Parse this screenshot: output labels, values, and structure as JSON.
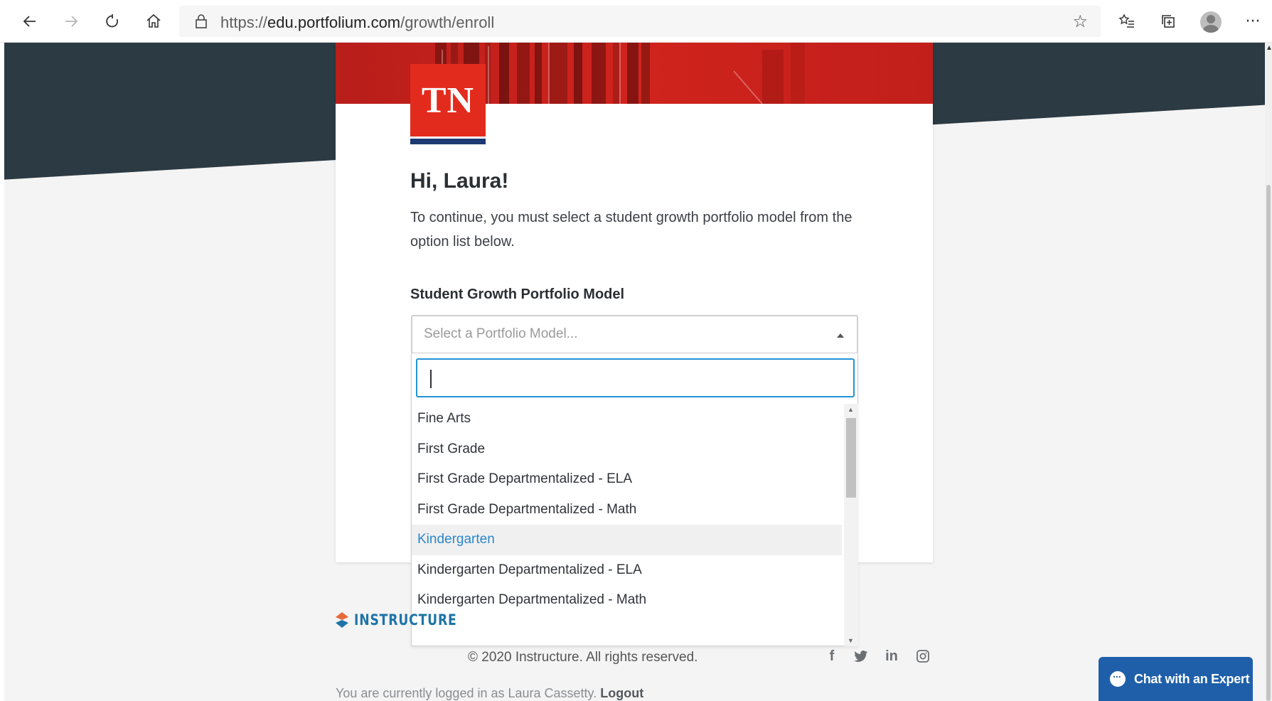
{
  "browser": {
    "url_prefix": "https://",
    "url_host": "edu.portfolium.com",
    "url_path": "/growth/enroll"
  },
  "card": {
    "logo_text": "TN",
    "greeting": "Hi, Laura!",
    "intro": "To continue, you must select a student growth portfolio model from the option list below.",
    "field_label": "Student Growth Portfolio Model",
    "select_placeholder": "Select a Portfolio Model...",
    "search_value": "",
    "options": [
      "Fine Arts",
      "First Grade",
      "First Grade Departmentalized - ELA",
      "First Grade Departmentalized - Math",
      "Kindergarten",
      "Kindergarten Departmentalized - ELA",
      "Kindergarten Departmentalized - Math"
    ],
    "active_option": "Kindergarten"
  },
  "footer": {
    "brand": "INSTRUCTURE",
    "copyright": "© 2020 Instructure. All rights reserved.",
    "logged_in_text": "You are currently logged in as Laura Cassetty.",
    "logout": "Logout",
    "social": {
      "facebook": "f",
      "linkedin": "in"
    }
  },
  "chat": {
    "label": "Chat with an Expert"
  },
  "colors": {
    "hero_dark": "#2c3a43",
    "tn_red": "#e32b1d",
    "tn_blue": "#1d3a72",
    "link_blue": "#2b87c9",
    "focus_blue": "#2493d8",
    "chat_blue": "#1f5fa9",
    "instructure_blue": "#1e74a8"
  }
}
